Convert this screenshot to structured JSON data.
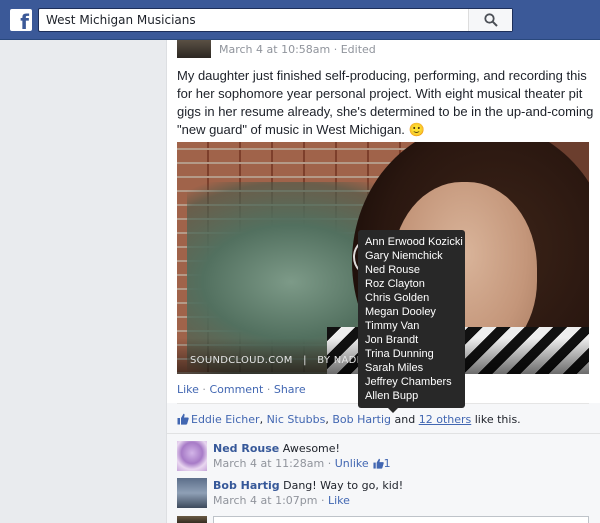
{
  "topbar": {
    "logo_letter": "f",
    "search": {
      "value": "West Michigan Musicians",
      "placeholder": ""
    },
    "search_icon": "search-icon"
  },
  "post": {
    "timestamp": "March 4 at 10:58am",
    "separator": " · ",
    "edited_label": "Edited",
    "text": "My daughter just finished self-producing, performing, and recording this for her sophomore year personal project. With eight musical theater pit gigs in her resume already, she's determined to be in the up-and-coming \"new guard\" of music in West Michigan. 🙂",
    "media": {
      "caption_source": "SOUNDCLOUD.COM",
      "caption_divider": "|",
      "caption_author": "BY NADIAJE"
    },
    "actions": {
      "like": "Like",
      "comment": "Comment",
      "share": "Share",
      "sep": " · "
    },
    "likes": {
      "icon": "thumbs-up-icon",
      "names": [
        "Eddie Eicher",
        "Nic Stubbs",
        "Bob Hartig"
      ],
      "comma": ", ",
      "and": " and ",
      "others_label": "12 others",
      "suffix": " like this."
    }
  },
  "tooltip": {
    "names": [
      "Ann Erwood Kozicki",
      "Gary Niemchick",
      "Ned Rouse",
      "Roz Clayton",
      "Chris Golden",
      "Megan Dooley",
      "Timmy Van",
      "Jon Brandt",
      "Trina Dunning",
      "Sarah Miles",
      "Jeffrey Chambers",
      "Allen Bupp"
    ]
  },
  "comments": [
    {
      "author": "Ned Rouse",
      "text": "Awesome!",
      "time": "March 4 at 11:28am",
      "action_label": "Unlike",
      "like_count": "1"
    },
    {
      "author": "Bob Hartig",
      "text": "Dang! Way to go, kid!",
      "time": "March 4 at 1:07pm",
      "action_label": "Like"
    }
  ],
  "colors": {
    "brand": "#3b5998",
    "link": "#4267b2",
    "meta": "#90949c",
    "tooltip_bg": "#282828"
  }
}
